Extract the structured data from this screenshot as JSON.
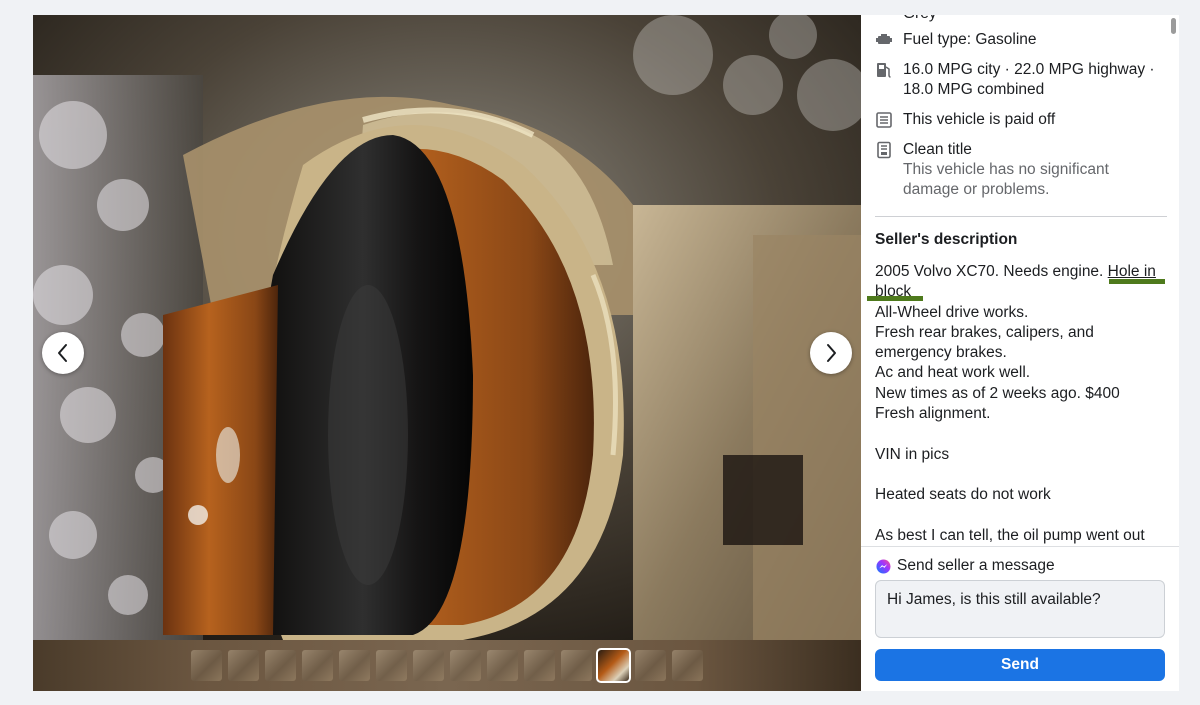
{
  "details": {
    "color_partial": "Grey",
    "fuel": "Fuel type: Gasoline",
    "mpg_line1": "16.0 MPG city · 22.0 MPG highway ·",
    "mpg_line2": "18.0 MPG combined",
    "paid_off": "This vehicle is paid off",
    "title_status": "Clean title",
    "title_sub_line1": "This vehicle has no significant",
    "title_sub_line2": "damage or problems."
  },
  "description": {
    "heading": "Seller's description",
    "line1_before": "2005 Volvo XC70. Needs engine. ",
    "line1_highlight": "Hole in",
    "line2_highlight": "block",
    "lines": [
      "All-Wheel drive works.",
      "Fresh rear brakes, calipers, and",
      "emergency brakes.",
      "Ac and heat work well.",
      "New times as of 2 weeks ago. $400",
      "Fresh alignment.",
      "",
      "VIN in pics",
      "",
      "Heated seats do not work",
      "",
      "As best I can tell, the oil pump went out"
    ]
  },
  "message": {
    "heading": "Send seller a message",
    "text": "Hi James, is this still available?",
    "send_label": "Send"
  },
  "thumbnails": {
    "count": 14,
    "active_index": 11
  },
  "colors": {
    "send_button": "#1b74e4",
    "annotation_marks": "#4e7a1c",
    "page_bg": "#f0f2f5"
  },
  "icons": [
    "engine-icon",
    "gas-pump-icon",
    "document-stack-icon",
    "title-document-icon",
    "messenger-icon",
    "chevron-left-icon",
    "chevron-right-icon"
  ]
}
